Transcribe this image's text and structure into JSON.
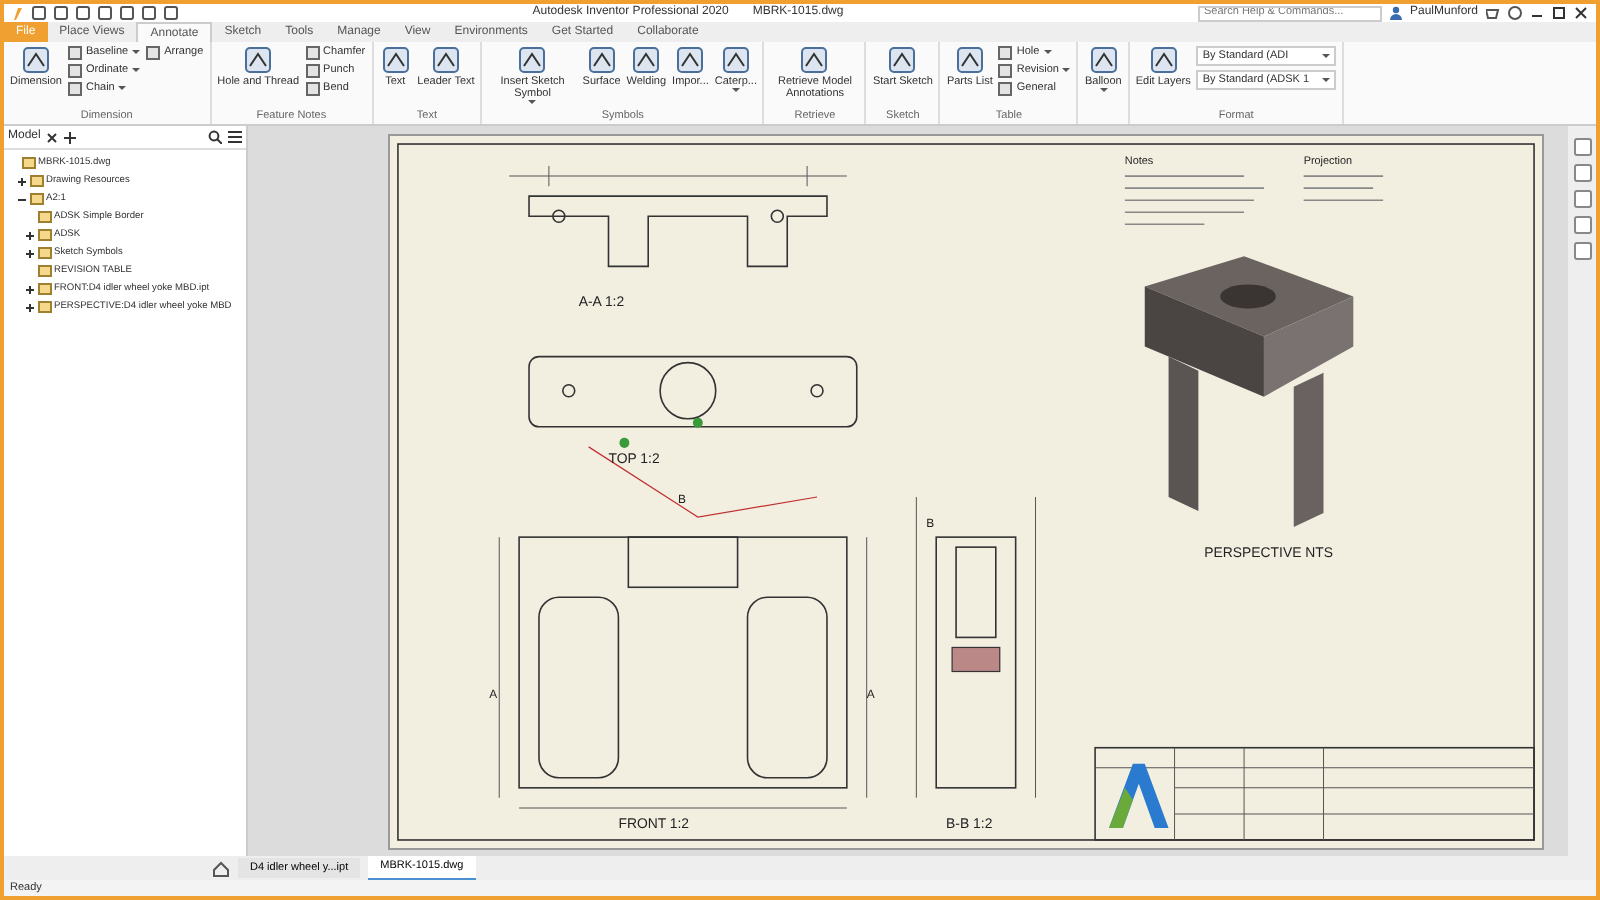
{
  "window": {
    "app_title": "Autodesk Inventor Professional 2020",
    "document_title": "MBRK-1015.dwg",
    "search": {
      "placeholder": "Search Help & Commands..."
    },
    "user": "PaulMunford"
  },
  "tabs": [
    {
      "label": "File",
      "selected": false,
      "kind": "file"
    },
    {
      "label": "Place Views",
      "selected": false,
      "kind": "tab"
    },
    {
      "label": "Annotate",
      "selected": true,
      "kind": "tab"
    },
    {
      "label": "Sketch",
      "selected": false,
      "kind": "tab"
    },
    {
      "label": "Tools",
      "selected": false,
      "kind": "tab"
    },
    {
      "label": "Manage",
      "selected": false,
      "kind": "tab"
    },
    {
      "label": "View",
      "selected": false,
      "kind": "tab"
    },
    {
      "label": "Environments",
      "selected": false,
      "kind": "tab"
    },
    {
      "label": "Get Started",
      "selected": false,
      "kind": "tab"
    },
    {
      "label": "Collaborate",
      "selected": false,
      "kind": "tab"
    }
  ],
  "ribbon": [
    {
      "label": "Dimension",
      "items": [
        {
          "kind": "large",
          "label": "Dimension"
        },
        {
          "kind": "small",
          "label": "Baseline",
          "dropdown": true
        },
        {
          "kind": "small",
          "label": "Ordinate",
          "dropdown": true
        },
        {
          "kind": "small",
          "label": "Chain",
          "dropdown": true
        },
        {
          "kind": "small",
          "label": "Arrange"
        }
      ]
    },
    {
      "label": "Feature Notes",
      "items": [
        {
          "kind": "large",
          "label": "Hole and Thread"
        },
        {
          "kind": "small",
          "label": "Chamfer"
        },
        {
          "kind": "small",
          "label": "Punch"
        },
        {
          "kind": "small",
          "label": "Bend"
        }
      ]
    },
    {
      "label": "Text",
      "items": [
        {
          "kind": "large",
          "label": "Text"
        },
        {
          "kind": "large",
          "label": "Leader Text"
        }
      ]
    },
    {
      "label": "Symbols",
      "items": [
        {
          "kind": "large",
          "label": "Insert Sketch Symbol",
          "dropdown": true
        },
        {
          "kind": "large",
          "label": "Surface"
        },
        {
          "kind": "large",
          "label": "Welding"
        },
        {
          "kind": "large",
          "label": "Impor..."
        },
        {
          "kind": "large",
          "label": "Caterp...",
          "dropdown": true
        }
      ]
    },
    {
      "label": "Retrieve",
      "items": [
        {
          "kind": "large",
          "label": "Retrieve Model Annotations"
        }
      ]
    },
    {
      "label": "Sketch",
      "items": [
        {
          "kind": "large",
          "label": "Start Sketch"
        }
      ]
    },
    {
      "label": "Table",
      "items": [
        {
          "kind": "large",
          "label": "Parts List"
        },
        {
          "kind": "small",
          "label": "Hole",
          "dropdown": true
        },
        {
          "kind": "small",
          "label": "Revision",
          "dropdown": true
        },
        {
          "kind": "small",
          "label": "General"
        }
      ]
    },
    {
      "items": [
        {
          "kind": "large",
          "label": "Balloon",
          "dropdown": true
        }
      ]
    },
    {
      "label": "Format",
      "items": [
        {
          "kind": "large",
          "label": "Edit Layers"
        },
        {
          "kind": "select",
          "label": "By Standard (ADI"
        },
        {
          "kind": "select",
          "label": "By Standard (ADSK 1"
        }
      ]
    }
  ],
  "browser": {
    "tab": "Model",
    "tree": [
      {
        "label": "MBRK-1015.dwg",
        "children": [
          {
            "label": "Drawing Resources",
            "expanded": false
          },
          {
            "label": "A2:1",
            "expanded": true,
            "children": [
              {
                "label": "ADSK Simple Border"
              },
              {
                "label": "ADSK",
                "expanded": false
              },
              {
                "label": "Sketch Symbols",
                "expanded": false
              },
              {
                "label": "REVISION TABLE"
              },
              {
                "label": "FRONT:D4 idler wheel yoke MBD.ipt",
                "expanded": false
              },
              {
                "label": "PERSPECTIVE:D4 idler wheel yoke MBD",
                "expanded": false
              }
            ]
          }
        ]
      }
    ]
  },
  "sheet": {
    "view_labels": [
      "A-A 1:2",
      "TOP 1:2",
      "FRONT 1:2",
      "B-B 1:2",
      "PERSPECTIVE NTS"
    ],
    "section_marks": [
      "B",
      "A",
      "A",
      "B"
    ],
    "notes_heading": "Notes",
    "projection_heading": "Projection"
  },
  "document_tabs": [
    {
      "label": "D4 idler wheel y...ipt",
      "selected": false
    },
    {
      "label": "MBRK-1015.dwg",
      "selected": true
    }
  ],
  "status_bar": "Ready"
}
